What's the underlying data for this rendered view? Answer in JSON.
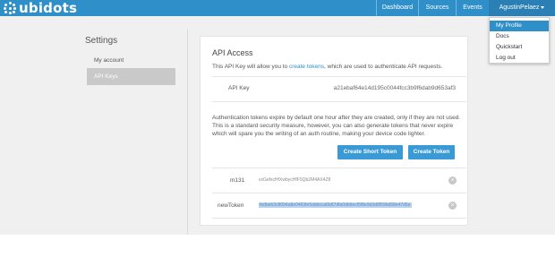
{
  "app": {
    "logo_text": "ubidots",
    "brand_color": "#2f8fc9"
  },
  "nav": {
    "dashboard": "Dashboard",
    "sources": "Sources",
    "events": "Events",
    "user": "AgustinPelaez"
  },
  "user_menu": {
    "items": [
      "My Profile",
      "Docs",
      "Quickstart",
      "Log out"
    ],
    "active_index": 0
  },
  "sidebar": {
    "title": "Settings",
    "items": [
      "My account",
      "API Keys"
    ],
    "active": "API Keys"
  },
  "api_access": {
    "title": "API Access",
    "desc_before": "This API Key will allow you to ",
    "desc_link": "create tokens",
    "desc_after": ", which are used to authenticate API requests.",
    "api_key_label": "API Key",
    "api_key_value": "a21ebaf64e14d195c0044fcc3b9f6dab9d653af3",
    "auth_note": "Authentication tokens expire by default one hour after they are created, only if they are not used. This is a standard security measure, however, you can also generate tokens that never expire which will spare you the writing of an auth routine, making your device code lighter.",
    "buttons": {
      "short_token": "Create Short Token",
      "token": "Create Token"
    },
    "tokens": [
      {
        "name": "m131",
        "value": "vzGefxcfHXwbycHfF5Qb2M4AX4Z8",
        "selected": false
      },
      {
        "name": "newToken",
        "value": "fedbeb3c8094a8e0463fe5dddcca6b87dfa0db6ecf5f8e9d3d8f59bd58e47d5e",
        "selected": true
      }
    ]
  }
}
